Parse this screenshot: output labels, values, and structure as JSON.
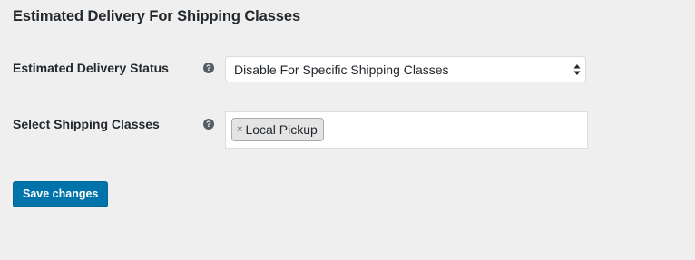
{
  "section": {
    "title": "Estimated Delivery For Shipping Classes"
  },
  "fields": {
    "status": {
      "label": "Estimated Delivery Status",
      "help_icon": "question-circle-icon",
      "selected_value": "Disable For Specific Shipping Classes"
    },
    "classes": {
      "label": "Select Shipping Classes",
      "help_icon": "question-circle-icon",
      "selected_tags": [
        {
          "remove_glyph": "×",
          "label": "Local Pickup"
        }
      ]
    }
  },
  "actions": {
    "save_label": "Save changes"
  },
  "colors": {
    "background": "#efefef",
    "primary_button": "#0073aa",
    "help_icon": "#555d66"
  }
}
